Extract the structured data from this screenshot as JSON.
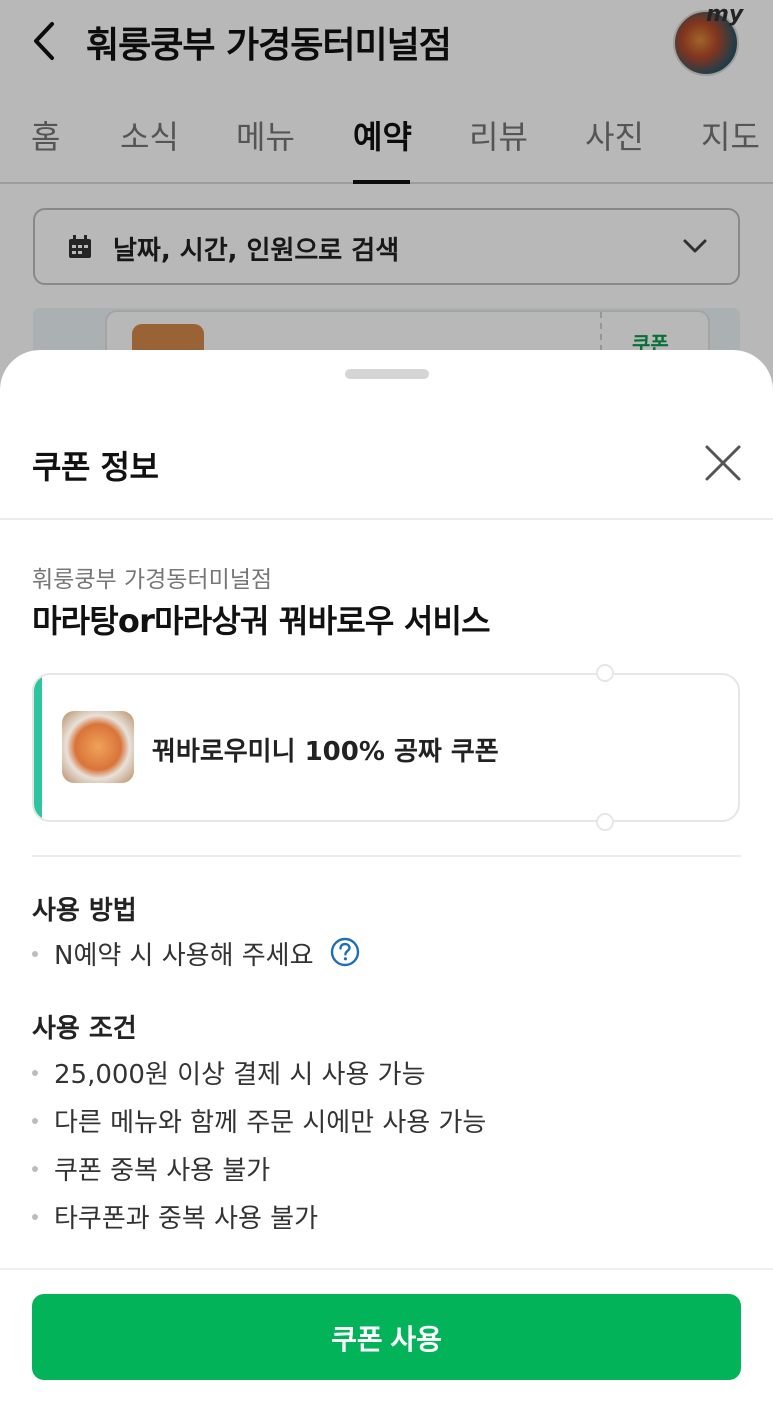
{
  "header": {
    "title": "훠룽쿵부 가경동터미널점",
    "avatar_text": "my"
  },
  "tabs": [
    {
      "label": "홈"
    },
    {
      "label": "소식"
    },
    {
      "label": "메뉴"
    },
    {
      "label": "예약",
      "active": true
    },
    {
      "label": "리뷰"
    },
    {
      "label": "사진"
    },
    {
      "label": "지도"
    }
  ],
  "search": {
    "label": "날짜, 시간, 인원으로 검색"
  },
  "background_card": {
    "coupon_tag": "쿠폰"
  },
  "sheet": {
    "title": "쿠폰 정보",
    "store_name": "훠룽쿵부 가경동터미널점",
    "coupon_title": "마라탕or마라상궈 꿔바로우 서비스",
    "coupon_label": "꿔바로우미니 100% 공짜 쿠폰",
    "usage": {
      "heading": "사용 방법",
      "items": [
        "N예약 시 사용해 주세요"
      ]
    },
    "conditions": {
      "heading": "사용 조건",
      "items": [
        "25,000원 이상 결제 시 사용 가능",
        "다른 메뉴와 함께 주문 시에만 사용 가능",
        "쿠폰 중복 사용 불가",
        "타쿠폰과 중복 사용 불가"
      ]
    },
    "button_label": "쿠폰 사용"
  },
  "colors": {
    "primary_green": "#03b359",
    "coupon_accent": "#2bc5a0",
    "help_icon": "#1f6fb5"
  }
}
